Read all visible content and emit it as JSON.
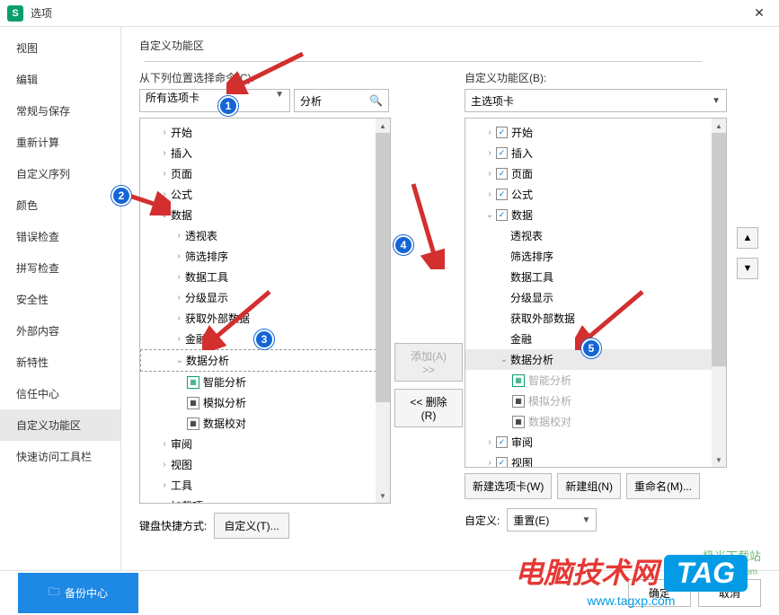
{
  "title": "选项",
  "sidebar": {
    "items": [
      {
        "label": "视图"
      },
      {
        "label": "编辑"
      },
      {
        "label": "常规与保存"
      },
      {
        "label": "重新计算"
      },
      {
        "label": "自定义序列"
      },
      {
        "label": "颜色"
      },
      {
        "label": "错误检查"
      },
      {
        "label": "拼写检查"
      },
      {
        "label": "安全性"
      },
      {
        "label": "外部内容"
      },
      {
        "label": "新特性"
      },
      {
        "label": "信任中心"
      },
      {
        "label": "自定义功能区"
      },
      {
        "label": "快速访问工具栏"
      }
    ]
  },
  "section_title": "自定义功能区",
  "left": {
    "label": "从下列位置选择命令(C):",
    "combo": "所有选项卡",
    "search": "分析",
    "tree": [
      {
        "t": ">",
        "label": "开始",
        "lvl": 1
      },
      {
        "t": ">",
        "label": "插入",
        "lvl": 1
      },
      {
        "t": ">",
        "label": "页面",
        "lvl": 1
      },
      {
        "t": ">",
        "label": "公式",
        "lvl": 1
      },
      {
        "t": "v",
        "label": "数据",
        "lvl": 1
      },
      {
        "t": ">",
        "label": "透视表",
        "lvl": 2
      },
      {
        "t": ">",
        "label": "筛选排序",
        "lvl": 2
      },
      {
        "t": ">",
        "label": "数据工具",
        "lvl": 2
      },
      {
        "t": ">",
        "label": "分级显示",
        "lvl": 2
      },
      {
        "t": ">",
        "label": "获取外部数据",
        "lvl": 2
      },
      {
        "t": ">",
        "label": "金融",
        "lvl": 2
      },
      {
        "t": "v",
        "label": "数据分析",
        "lvl": 2,
        "selected": true
      },
      {
        "icon": "g",
        "label": "智能分析",
        "lvl": 3
      },
      {
        "icon": "b",
        "label": "模拟分析",
        "lvl": 3
      },
      {
        "icon": "b",
        "label": "数据校对",
        "lvl": 3
      },
      {
        "t": ">",
        "label": "审阅",
        "lvl": 1
      },
      {
        "t": ">",
        "label": "视图",
        "lvl": 1
      },
      {
        "t": ">",
        "label": "工具",
        "lvl": 1
      },
      {
        "t": ">",
        "label": "加载项",
        "lvl": 1
      }
    ],
    "shortcut_label": "键盘快捷方式:",
    "shortcut_btn": "自定义(T)..."
  },
  "mid": {
    "add": "添加(A) >>",
    "remove": "<< 删除(R)"
  },
  "right": {
    "label": "自定义功能区(B):",
    "combo": "主选项卡",
    "tree": [
      {
        "t": ">",
        "chk": true,
        "label": "开始",
        "lvl": 1
      },
      {
        "t": ">",
        "chk": true,
        "label": "插入",
        "lvl": 1
      },
      {
        "t": ">",
        "chk": true,
        "label": "页面",
        "lvl": 1
      },
      {
        "t": ">",
        "chk": true,
        "label": "公式",
        "lvl": 1
      },
      {
        "t": "v",
        "chk": true,
        "label": "数据",
        "lvl": 1
      },
      {
        "t": "",
        "label": "透视表",
        "lvl": 2
      },
      {
        "t": "",
        "label": "筛选排序",
        "lvl": 2
      },
      {
        "t": "",
        "label": "数据工具",
        "lvl": 2
      },
      {
        "t": "",
        "label": "分级显示",
        "lvl": 2
      },
      {
        "t": "",
        "label": "获取外部数据",
        "lvl": 2
      },
      {
        "t": "",
        "label": "金融",
        "lvl": 2
      },
      {
        "t": "v",
        "label": "数据分析",
        "lvl": 2,
        "highlighted": true
      },
      {
        "icon": "g",
        "label": "智能分析",
        "lvl": 3,
        "disabled": true
      },
      {
        "icon": "b",
        "label": "模拟分析",
        "lvl": 3,
        "disabled": true
      },
      {
        "icon": "b",
        "label": "数据校对",
        "lvl": 3,
        "disabled": true
      },
      {
        "t": ">",
        "chk": true,
        "label": "审阅",
        "lvl": 1
      },
      {
        "t": ">",
        "chk": true,
        "label": "视图",
        "lvl": 1
      }
    ],
    "btns": {
      "newtab": "新建选项卡(W)",
      "newgrp": "新建组(N)",
      "rename": "重命名(M)..."
    },
    "custom_label": "自定义:",
    "reset": "重置(E)"
  },
  "footer": {
    "backup": "备份中心",
    "ok": "确定",
    "cancel": "取消"
  },
  "watermark": {
    "red": "电脑技术网",
    "tag": "TAG",
    "url": "www.tagxp.com",
    "jg": "极光下载站",
    "jgurl": "www.xz7.com"
  }
}
